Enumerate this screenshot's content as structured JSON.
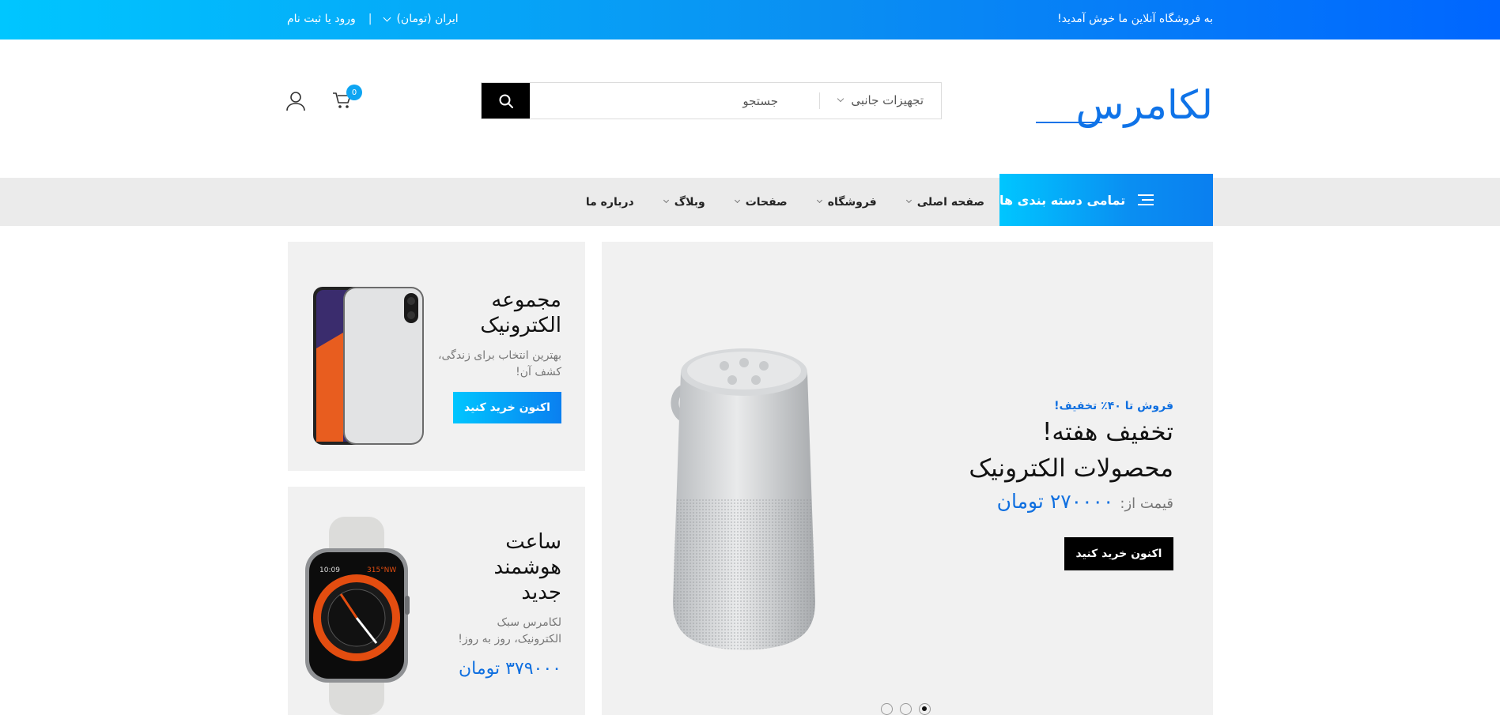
{
  "topbar": {
    "welcome": "به فروشگاه آنلاین ما خوش آمدید!",
    "currency": "ایران (تومان)",
    "separator": "|",
    "login": "ورود یا ثبت نام"
  },
  "header": {
    "logo": "لکامرس",
    "search": {
      "category": "تجهیزات جانبی",
      "placeholder": "جستجو"
    },
    "cart_count": "0"
  },
  "nav": {
    "all_categories": "تمامی دسته بندی ها",
    "items": [
      {
        "label": "صفحه اصلی"
      },
      {
        "label": "فروشگاه"
      },
      {
        "label": "صفحات"
      },
      {
        "label": "وبلاگ"
      },
      {
        "label": "درباره ما"
      }
    ]
  },
  "hero": {
    "subtitle": "فروش تا ۴۰٪ تخفیف!",
    "title_line1": "تخفیف هفته!",
    "title_line2": "محصولات الکترونیک",
    "price_label": "قیمت از:",
    "price_value": "۲۷۰۰۰۰ تومان",
    "button": "اکنون خرید کنید",
    "slides": 3,
    "active_slide": 1
  },
  "side_banner_1": {
    "title_line1": "مجموعه",
    "title_line2": "الکترونیک",
    "desc_line1": "بهترین انتخاب برای زندگی،",
    "desc_line2": "کشف آن!",
    "button": "اکنون خرید کنید"
  },
  "side_banner_2": {
    "title_line1": "ساعت",
    "title_line2": "هوشمند",
    "title_line3": "جدید",
    "desc_line1": "لکامرس سبک",
    "desc_line2": "الکترونیک، روز به روز!",
    "price": "۳۷۹۰۰۰ تومان",
    "watch_time": "10:09",
    "watch_reading": "315°NW"
  },
  "colors": {
    "accent": "#0f73e8",
    "gradient_start": "#00c6ff",
    "gradient_end": "#0066ff",
    "banner_bg": "#f1f1f1",
    "nav_bg": "#ebebeb"
  }
}
